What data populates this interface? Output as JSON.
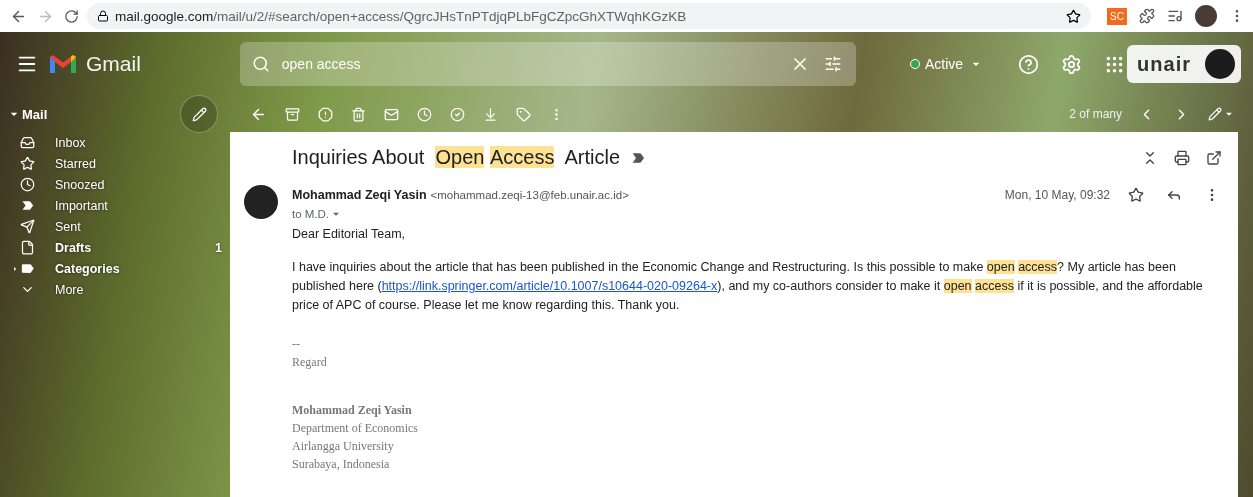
{
  "browser": {
    "url_domain": "mail.google.com",
    "url_path": "/mail/u/2/#search/open+access/QgrcJHsTnPTdjqPLbFgCZpcGhXTWqhKGzKB",
    "forward_disabled": true,
    "extension_badge": "SC"
  },
  "header": {
    "app_name": "Gmail",
    "search": {
      "value": "open access"
    },
    "status": {
      "label": "Active",
      "color": "#34a853"
    },
    "logo_text": "unair"
  },
  "sidebar": {
    "section": "Mail",
    "items": [
      {
        "label": "Inbox",
        "bold": false,
        "expandable": false
      },
      {
        "label": "Starred",
        "bold": false,
        "expandable": false
      },
      {
        "label": "Snoozed",
        "bold": false,
        "expandable": false
      },
      {
        "label": "Important",
        "bold": false,
        "expandable": false
      },
      {
        "label": "Sent",
        "bold": false,
        "expandable": false
      },
      {
        "label": "Drafts",
        "bold": true,
        "expandable": false,
        "count": "1"
      },
      {
        "label": "Categories",
        "bold": true,
        "expandable": true
      },
      {
        "label": "More",
        "bold": false,
        "expandable": false
      }
    ]
  },
  "toolbar": {
    "pager": "2 of many"
  },
  "message": {
    "subject": [
      {
        "text": "Inquiries About ",
        "highlighted": false
      },
      {
        "text": "Open",
        "highlighted": true
      },
      {
        "text": "Access",
        "highlighted": true
      },
      {
        "text": " Article",
        "highlighted": false
      }
    ],
    "sender_name": "Mohammad Zeqi Yasin",
    "sender_email": "<mohammad.zeqi-13@feb.unair.ac.id>",
    "recipient": "to M.D.",
    "date": "Mon, 10 May, 09:32",
    "greeting": "Dear Editorial Team,",
    "body": [
      {
        "kind": "text",
        "text": "I have inquiries about the article that has been published in the Economic Change and Restructuring. Is this possible to make "
      },
      {
        "kind": "highlight",
        "text": "open"
      },
      {
        "kind": "highlight",
        "text": "access"
      },
      {
        "kind": "text",
        "text": "? My article has been published here ("
      },
      {
        "kind": "link",
        "text": "https://link.springer.com/article/10.1007/s10644-020-09264-x"
      },
      {
        "kind": "text",
        "text": "), and my co-authors consider to make it "
      },
      {
        "kind": "highlight",
        "text": "open"
      },
      {
        "kind": "highlight",
        "text": "access"
      },
      {
        "kind": "text",
        "text": " if it is possible, and the affordable price of APC of course. Please let me know regarding this. Thank you."
      }
    ],
    "signature_separator": "--",
    "closing": "Regard",
    "signature": [
      {
        "text": "Mohammad Zeqi Yasin",
        "bold": true
      },
      {
        "text": "Department of Economics",
        "bold": false
      },
      {
        "text": "Airlangga University",
        "bold": false
      },
      {
        "text": "Surabaya, Indonesia",
        "bold": false
      }
    ]
  }
}
